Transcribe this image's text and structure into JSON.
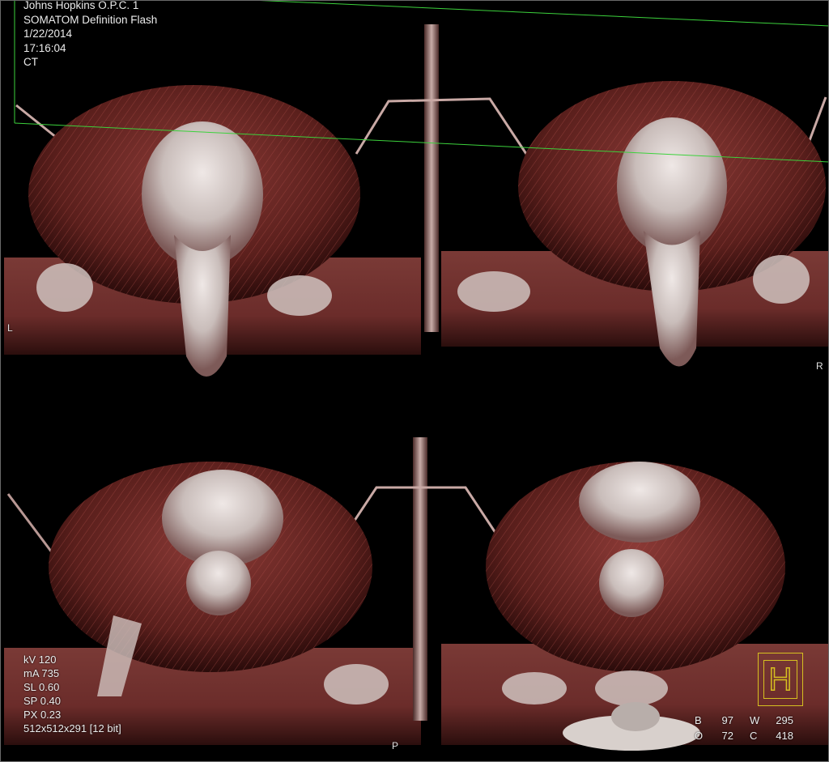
{
  "header": {
    "institution": "Johns Hopkins O.P.C. 1",
    "scanner": "SOMATOM Definition Flash",
    "date": "1/22/2014",
    "time": "17:16:04",
    "modality": "CT"
  },
  "orientation": {
    "left": "L",
    "right": "R",
    "posterior": "P"
  },
  "acquisition": {
    "kv": "kV 120",
    "ma": "mA 735",
    "sl": "SL 0.60",
    "sp": "SP 0.40",
    "px": "PX 0.23",
    "matrix": "512x512x291 [12 bit]"
  },
  "window_level": {
    "b_label": "B",
    "b_value": "97",
    "w_label": "W",
    "w_value": "295",
    "o_label": "O",
    "o_value": "72",
    "c_label": "C",
    "c_value": "418"
  },
  "logo": {
    "letter": "H"
  },
  "colors": {
    "overlay_text": "#ececec",
    "reference_line": "#3cd23c",
    "logo": "#d6c020",
    "tissue": "#7a2a2a",
    "bone": "#d9cfcb"
  },
  "viewport": {
    "panels": [
      "top-left",
      "top-right",
      "bottom-left",
      "bottom-right"
    ],
    "render_mode": "3D volume rendering"
  }
}
